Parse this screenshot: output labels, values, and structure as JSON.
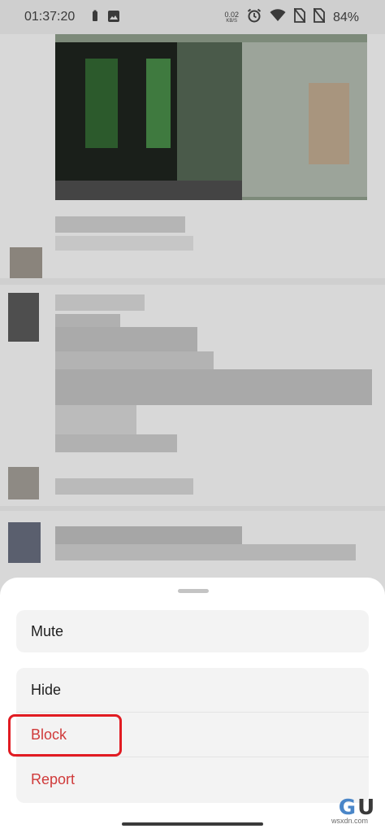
{
  "status_bar": {
    "time": "01:37:20",
    "data_rate_value": "0.02",
    "data_rate_unit": "KB/S",
    "battery_percent": "84%",
    "icons": [
      "battery-saver-icon",
      "image-notification-icon",
      "alarm-icon",
      "wifi-icon",
      "no-sim-icon",
      "no-sim-icon",
      "battery-icon"
    ]
  },
  "sheet": {
    "group1": [
      {
        "label": "Mute"
      }
    ],
    "group2": [
      {
        "label": "Hide"
      },
      {
        "label": "Block"
      },
      {
        "label": "Report"
      }
    ]
  },
  "colors": {
    "danger": "#d03a3a",
    "highlight": "#e11b22",
    "sheet_bg": "#ffffff",
    "item_bg": "#f3f3f3"
  },
  "watermark": {
    "logo": "GU",
    "text": "wsxdn.com"
  }
}
